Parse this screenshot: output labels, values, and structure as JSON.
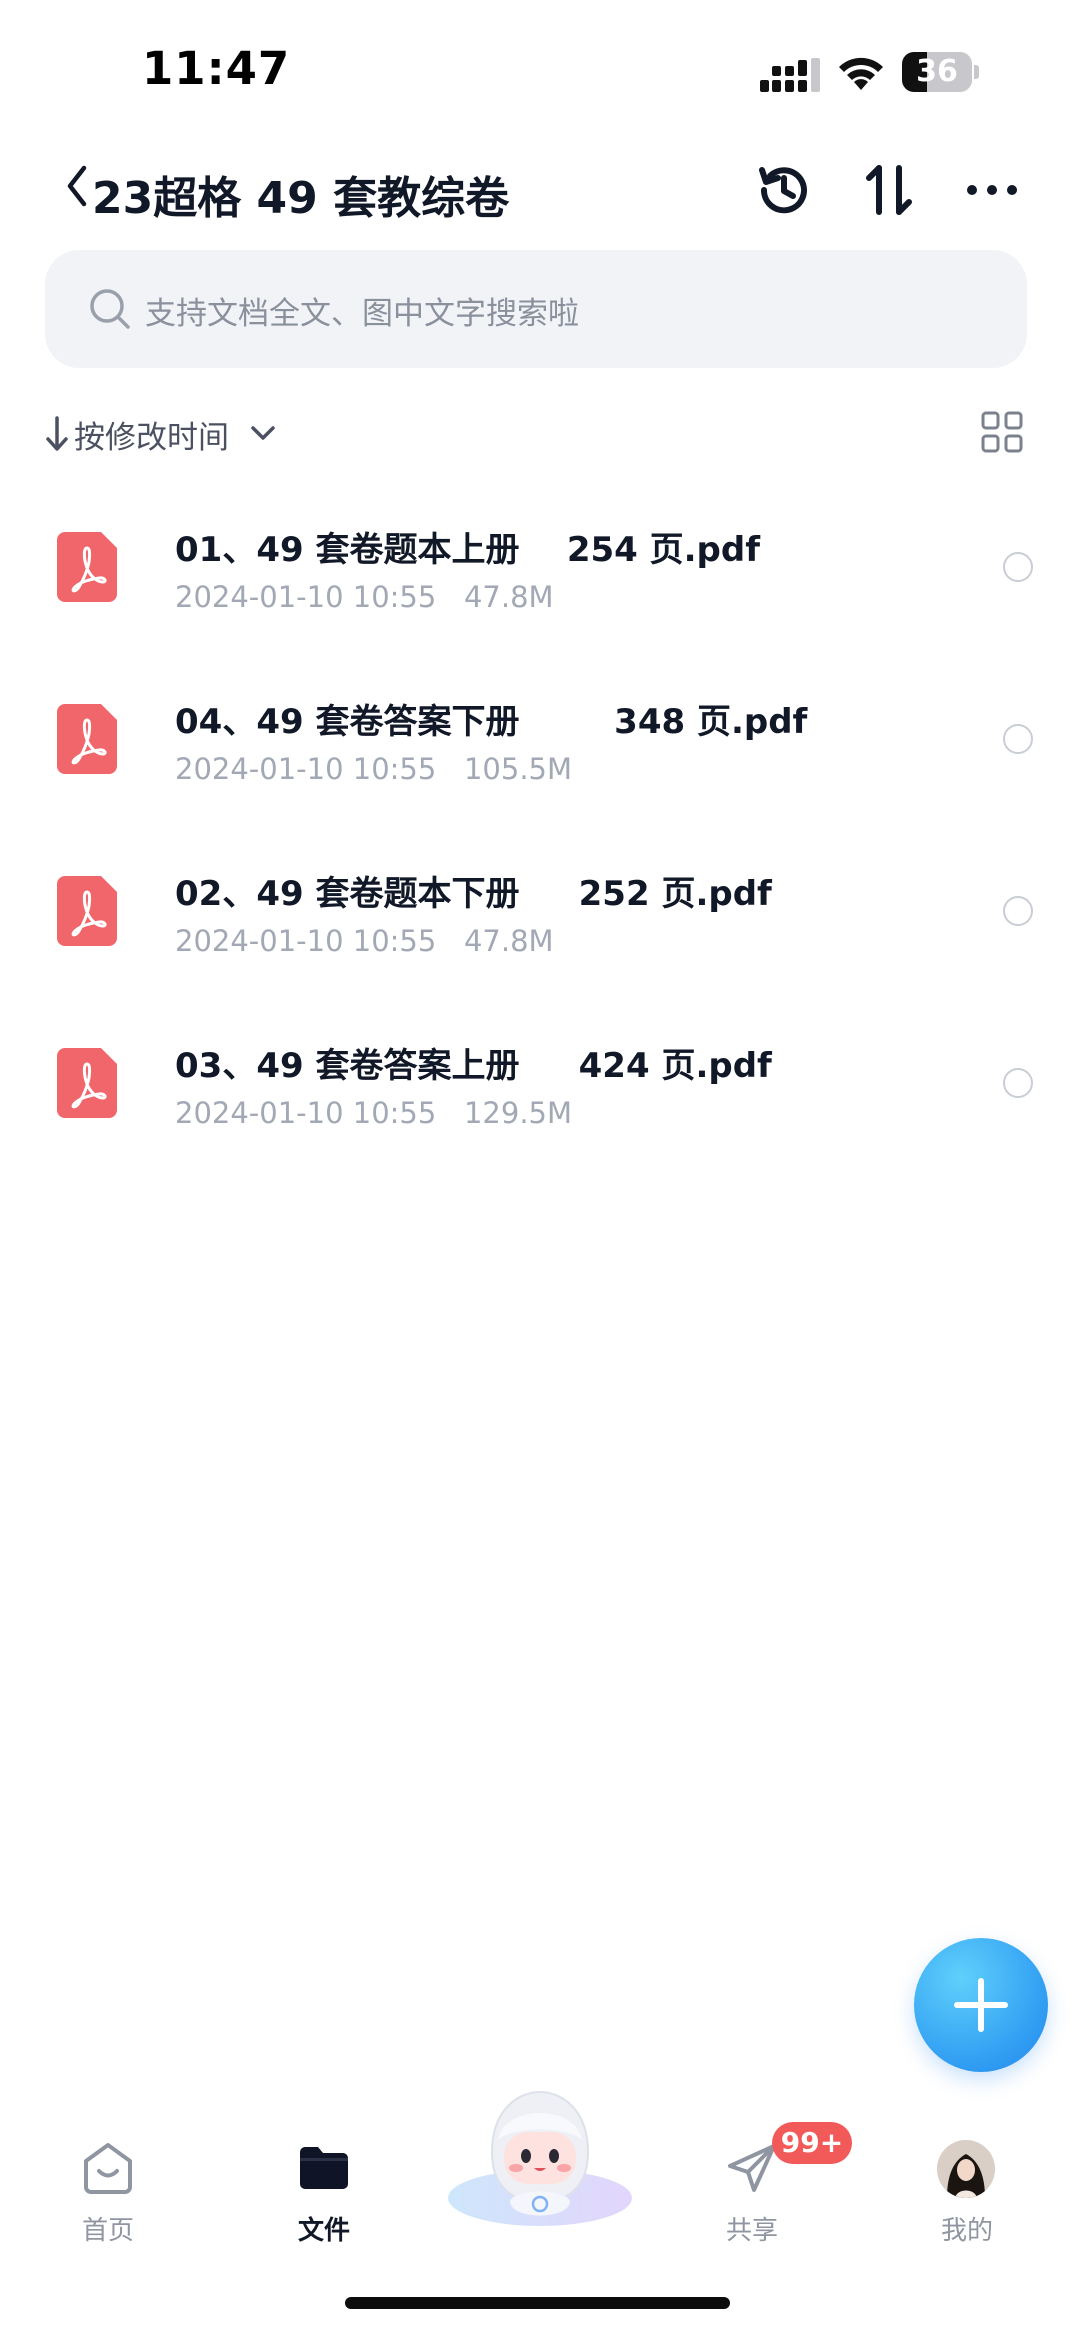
{
  "status_bar": {
    "time": "11:47",
    "battery": "36",
    "battery_level": 0.36
  },
  "header": {
    "title": "23超格 49 套教综卷"
  },
  "search": {
    "placeholder": "支持文档全文、图中文字搜索啦"
  },
  "sort": {
    "label": "按修改时间"
  },
  "files": [
    {
      "name": "01、49 套卷题本上册    254 页.pdf",
      "date": "2024-01-10 10:55",
      "size": "47.8M"
    },
    {
      "name": "04、49 套卷答案下册        348 页.pdf",
      "date": "2024-01-10 10:55",
      "size": "105.5M"
    },
    {
      "name": "02、49 套卷题本下册     252 页.pdf",
      "date": "2024-01-10 10:55",
      "size": "47.8M"
    },
    {
      "name": "03、49 套卷答案上册     424 页.pdf",
      "date": "2024-01-10 10:55",
      "size": "129.5M"
    }
  ],
  "tabbar": {
    "home": "首页",
    "files": "文件",
    "share": "共享",
    "share_badge": "99+",
    "mine": "我的"
  },
  "colors": {
    "pdf_red": "#f0666b",
    "accent_blue": "#2f9cf2",
    "badge_red": "#f25a5a"
  }
}
